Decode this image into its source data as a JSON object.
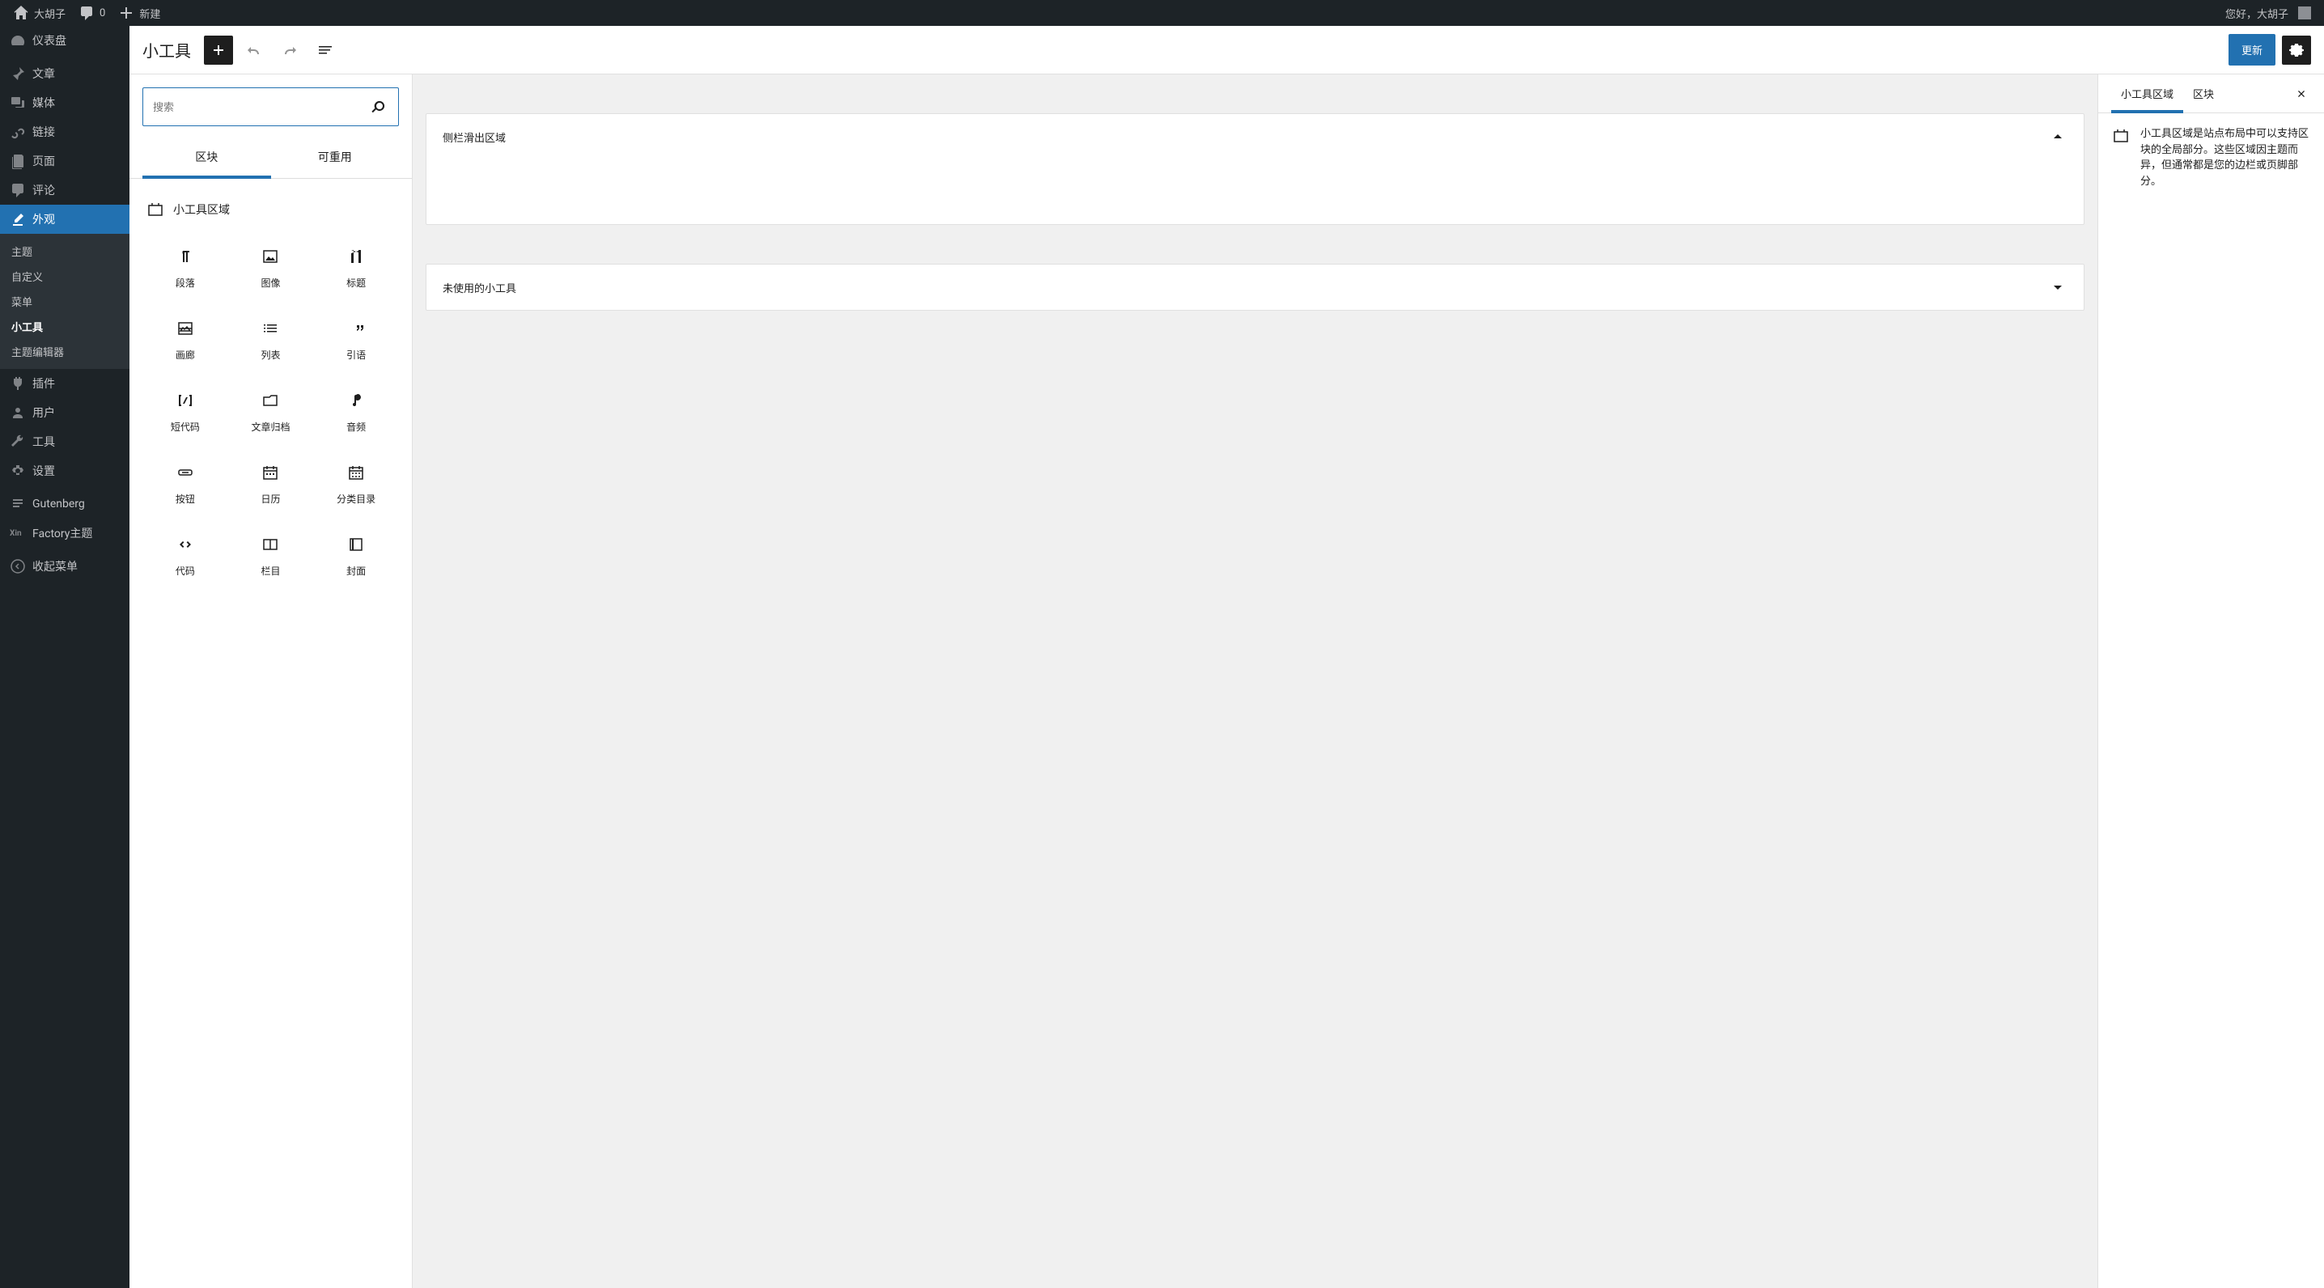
{
  "toolbar": {
    "site_name": "大胡子",
    "comments_count": "0",
    "new_label": "新建",
    "greeting": "您好，大胡子"
  },
  "adminmenu": {
    "dashboard": "仪表盘",
    "posts": "文章",
    "media": "媒体",
    "links": "链接",
    "pages": "页面",
    "comments": "评论",
    "appearance": "外观",
    "appearance_sub": {
      "themes": "主题",
      "customize": "自定义",
      "menus": "菜单",
      "widgets": "小工具",
      "editor": "主题编辑器"
    },
    "plugins": "插件",
    "users": "用户",
    "tools": "工具",
    "settings": "设置",
    "gutenberg": "Gutenberg",
    "factory": "Factory主题",
    "collapse": "收起菜单"
  },
  "editor": {
    "title": "小工具",
    "update_btn": "更新",
    "search_placeholder": "搜索",
    "tabs": {
      "blocks": "区块",
      "reusable": "可重用"
    },
    "category_label": "小工具区域",
    "blocks": [
      {
        "label": "段落",
        "icon": "paragraph"
      },
      {
        "label": "图像",
        "icon": "image"
      },
      {
        "label": "标题",
        "icon": "heading"
      },
      {
        "label": "画廊",
        "icon": "gallery"
      },
      {
        "label": "列表",
        "icon": "list"
      },
      {
        "label": "引语",
        "icon": "quote"
      },
      {
        "label": "短代码",
        "icon": "shortcode"
      },
      {
        "label": "文章归档",
        "icon": "archive"
      },
      {
        "label": "音频",
        "icon": "audio"
      },
      {
        "label": "按钮",
        "icon": "button"
      },
      {
        "label": "日历",
        "icon": "calendar"
      },
      {
        "label": "分类目录",
        "icon": "categories"
      },
      {
        "label": "代码",
        "icon": "code"
      },
      {
        "label": "栏目",
        "icon": "columns"
      },
      {
        "label": "封面",
        "icon": "cover"
      }
    ],
    "areas": [
      {
        "title": "侧栏滑出区域",
        "open": true
      },
      {
        "title": "未使用的小工具",
        "open": false
      }
    ]
  },
  "sidebar": {
    "tab1": "小工具区域",
    "tab2": "区块",
    "description": "小工具区域是站点布局中可以支持区块的全局部分。这些区域因主题而异，但通常都是您的边栏或页脚部分。"
  }
}
